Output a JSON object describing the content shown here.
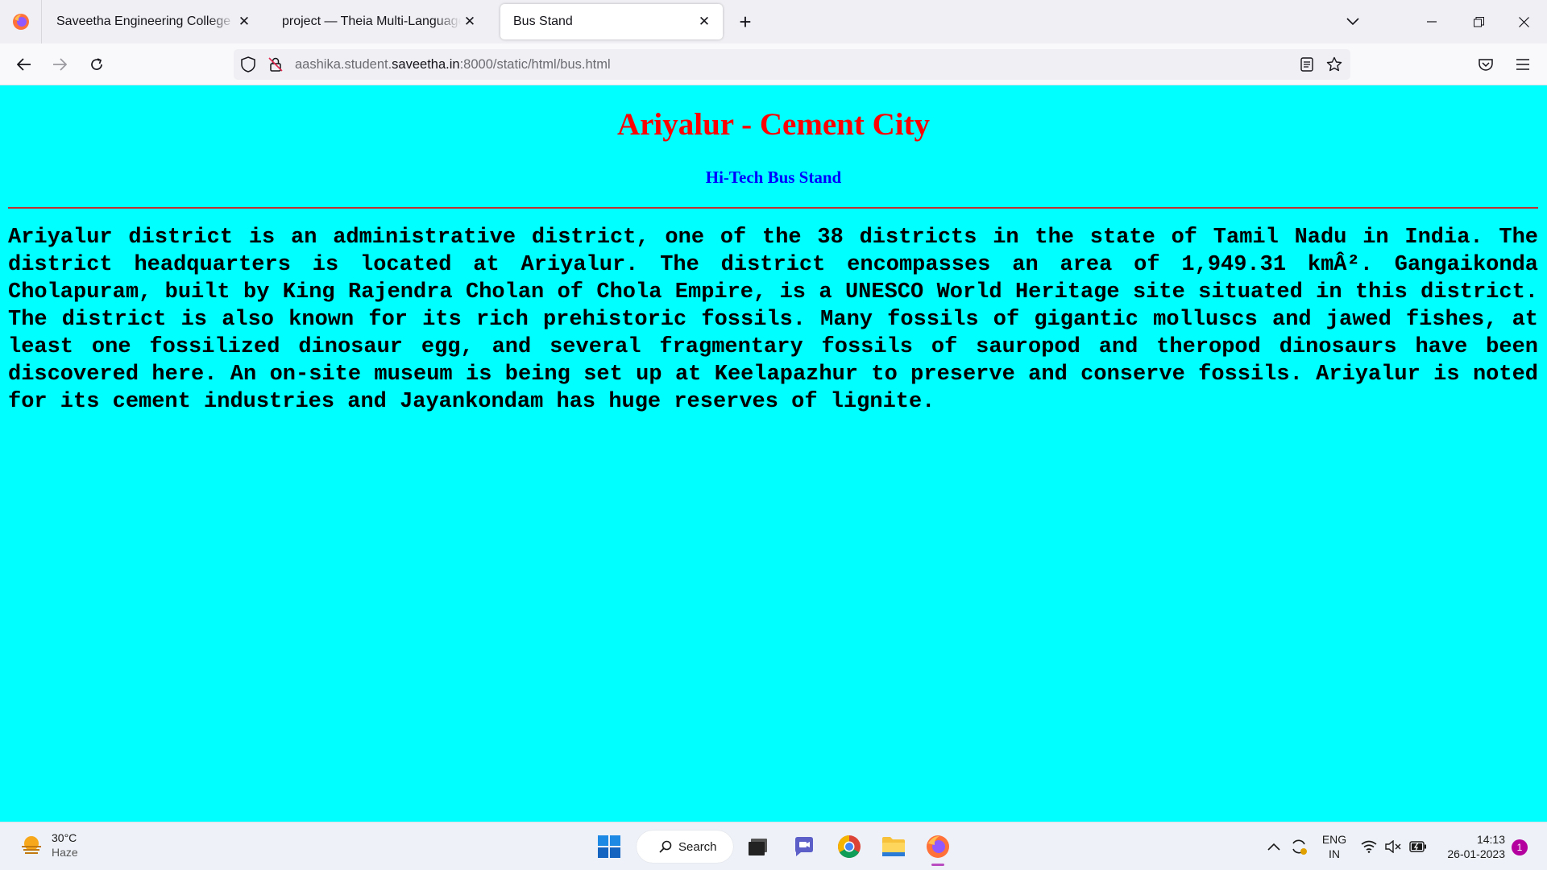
{
  "browser": {
    "tabs": [
      {
        "label": "Saveetha Engineering College",
        "close": "✕"
      },
      {
        "label": "project — Theia Multi-Language Example",
        "close": "✕"
      },
      {
        "label": "Bus Stand",
        "close": "✕",
        "active": true
      }
    ],
    "new_tab": "+",
    "url": {
      "prefix": "aashika.student.",
      "host": "saveetha.in",
      "suffix": ":8000/static/html/bus.html"
    }
  },
  "page": {
    "title": "Ariyalur - Cement City",
    "subtitle": "Hi-Tech Bus Stand",
    "paragraph": "Ariyalur district is an administrative district, one of the 38 districts in the state of Tamil Nadu in India. The district headquarters is located at Ariyalur. The district encompasses an area of 1,949.31 kmÂ². Gangaikonda Cholapuram, built by King Rajendra Cholan of Chola Empire, is a UNESCO World Heritage site situated in this district. The district is also known for its rich prehistoric fossils. Many fossils of gigantic molluscs and jawed fishes, at least one fossilized dinosaur egg, and several fragmentary fossils of sauropod and theropod dinosaurs have been discovered here. An on-site museum is being set up at Keelapazhur to preserve and conserve fossils. Ariyalur is noted for its cement industries and Jayankondam has huge reserves of lignite.",
    "colors": {
      "background": "#00ffff",
      "title": "#ff0000",
      "subtitle": "#0000ff",
      "rule": "#c03030"
    }
  },
  "taskbar": {
    "weather": {
      "temp": "30°C",
      "condition": "Haze"
    },
    "search_label": "Search",
    "language": {
      "line1": "ENG",
      "line2": "IN"
    },
    "time": "14:13",
    "date": "26-01-2023",
    "notification_count": "1"
  }
}
